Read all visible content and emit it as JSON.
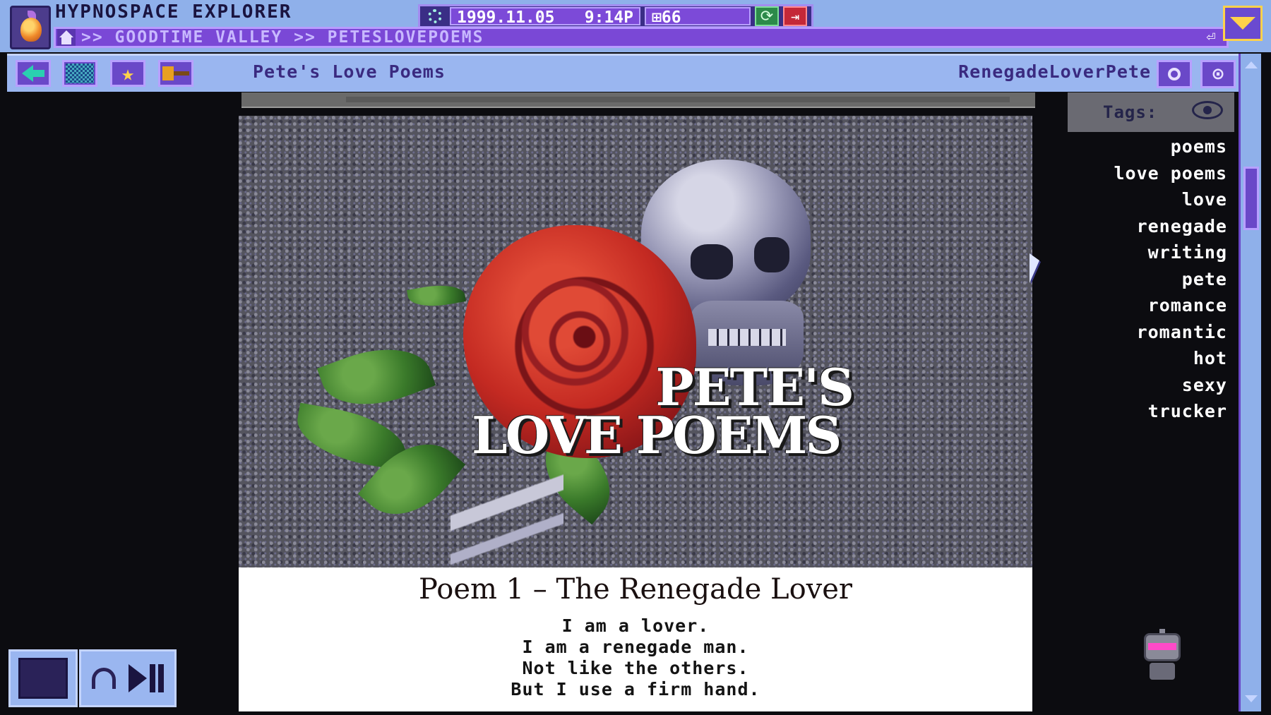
{
  "app": {
    "title": "HYPNOSPACE EXPLORER",
    "date": "1999.11.05",
    "time": "9:14P",
    "memory": "⊞66",
    "address": ">> GOODTIME VALLEY >> PETESLOVEPOEMS"
  },
  "toolbar": {
    "page_title": "Pete's Love Poems",
    "user": "RenegadeLoverPete",
    "icons": [
      "back-arrow-icon",
      "grid-icon",
      "star-icon",
      "hammer-icon",
      "search-icon",
      "help-icon"
    ]
  },
  "page": {
    "banner": {
      "line1": "PETE'S",
      "line2": "LOVE POEMS"
    },
    "poem": {
      "title": "Poem 1 – The Renegade Lover",
      "lines": [
        "I am a lover.",
        "I am a renegade man.",
        "Not like the others.",
        "But I use a firm hand."
      ]
    }
  },
  "tags": {
    "label": "Tags:",
    "items": [
      "poems",
      "love poems",
      "love",
      "renegade",
      "writing",
      "pete",
      "romance",
      "romantic",
      "hot",
      "sexy",
      "trucker"
    ]
  },
  "colors": {
    "chrome": "#8fb0ea",
    "accent": "#7a48d6",
    "highlight": "#ffd24a"
  }
}
